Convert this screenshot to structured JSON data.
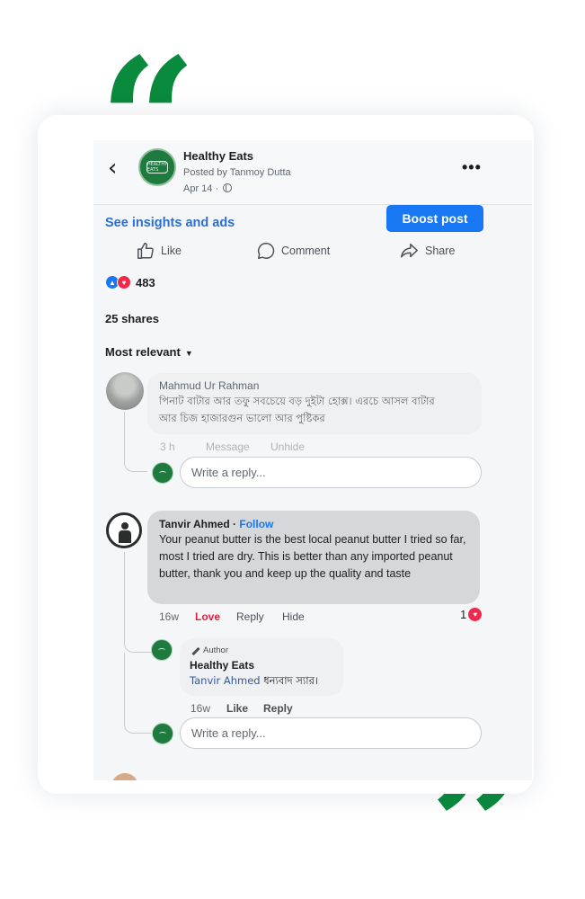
{
  "header": {
    "page_name": "Healthy Eats",
    "posted_by": "Posted by Tanmoy Dutta",
    "date": "Apr 14 ·",
    "avatar_badge": "HEALTHY EATS"
  },
  "post": {
    "insights_link": "See insights and ads",
    "boost_label": "Boost post",
    "actions": {
      "like": "Like",
      "comment": "Comment",
      "share": "Share"
    },
    "reaction_count": "483",
    "shares": "25 shares",
    "sort_label": "Most relevant"
  },
  "comments": [
    {
      "name": "Mahmud Ur Rahman",
      "text_line1": "পিনাট বাটার আর তফু সবচেয়ে বড় দুইটা হোক্স। এরচে আসল বাটার",
      "text_line2": "আর চিজ হাজারগুন ভালো আর পুষ্টিকর",
      "time": "3 h",
      "action1": "Message",
      "action2": "Unhide",
      "reply_placeholder": "Write a reply..."
    },
    {
      "name": "Tanvir Ahmed",
      "follow_sep": " · ",
      "follow": "Follow",
      "text": "Your peanut butter is the best local peanut butter I tried so far, most I tried are dry. This is  better than any imported peanut butter, thank you and keep up the quality and taste",
      "time": "16w",
      "love": "Love",
      "reply": "Reply",
      "hide": "Hide",
      "love_count": "1",
      "author_reply": {
        "badge": "Author",
        "name": "Healthy Eats",
        "mention": "Tanvir Ahmed",
        "text": " ধন্যবাদ স্যার।",
        "time": "16w",
        "like": "Like",
        "reply": "Reply"
      },
      "reply_placeholder": "Write a reply..."
    }
  ],
  "colors": {
    "quote_green": "#0a8a3c",
    "facebook_blue": "#1877f2",
    "love_red": "#e41e3f"
  }
}
